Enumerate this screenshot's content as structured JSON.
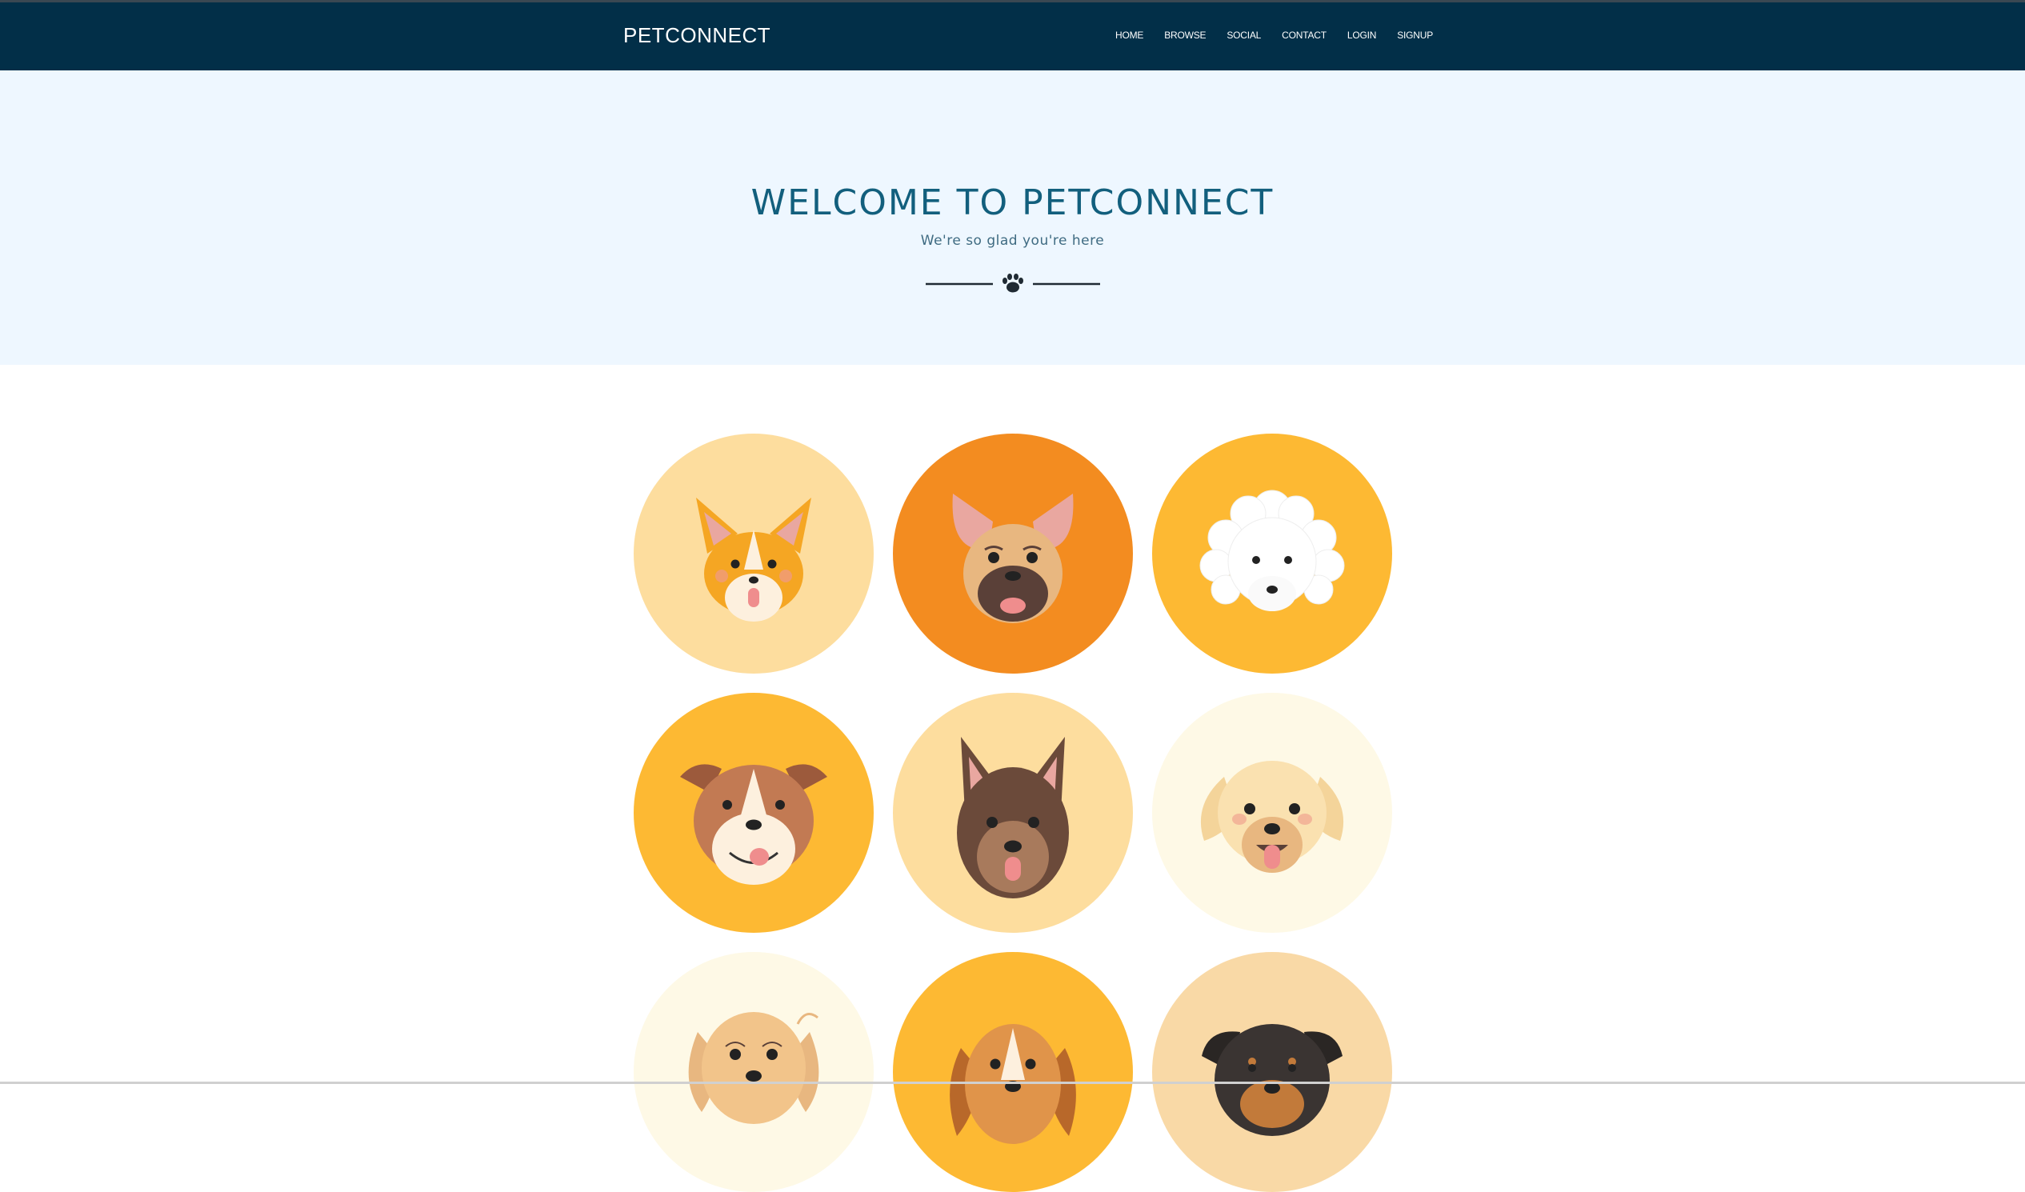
{
  "header": {
    "brand": "PETCONNECT",
    "nav": [
      "HOME",
      "BROWSE",
      "SOCIAL",
      "CONTACT",
      "LOGIN",
      "SIGNUP"
    ]
  },
  "hero": {
    "title": "WELCOME TO PETCONNECT",
    "subtitle": "We're so glad you're here",
    "divider_icon": "paw-icon"
  },
  "gallery": {
    "tiles": [
      {
        "icon": "corgi-icon",
        "background": "#fddd9e"
      },
      {
        "icon": "french-bulldog-icon",
        "background": "#f38c20"
      },
      {
        "icon": "poodle-icon",
        "background": "#fdb933"
      },
      {
        "icon": "bulldog-icon",
        "background": "#fdb933"
      },
      {
        "icon": "german-shepherd-icon",
        "background": "#fddd9e"
      },
      {
        "icon": "golden-retriever-icon",
        "background": "#fef9e6"
      },
      {
        "icon": "cocker-spaniel-icon",
        "background": "#fef9e6"
      },
      {
        "icon": "beagle-icon",
        "background": "#fdb933"
      },
      {
        "icon": "rottweiler-icon",
        "background": "#f9d9a6"
      }
    ]
  },
  "colors": {
    "navbar": "#022f48",
    "hero_background": "#eef7ff",
    "title": "#125f7d",
    "subtitle": "#3f6b82"
  }
}
